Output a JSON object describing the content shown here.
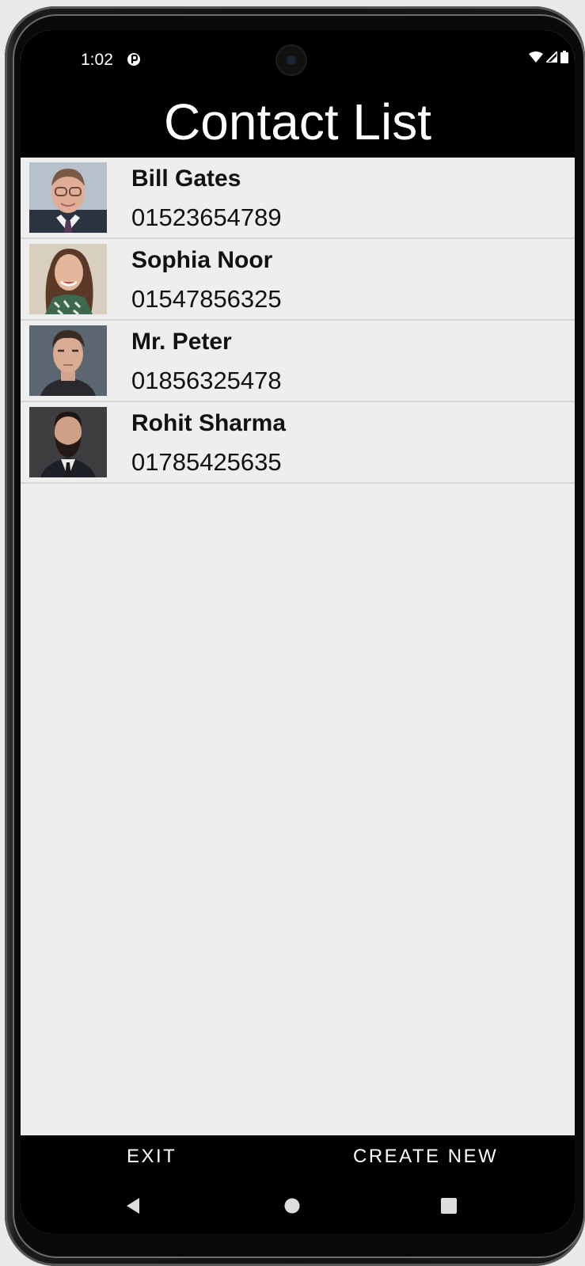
{
  "status_bar": {
    "time": "1:02"
  },
  "app": {
    "title": "Contact List"
  },
  "contacts": [
    {
      "name": "Bill Gates",
      "phone": "01523654789"
    },
    {
      "name": "Sophia Noor",
      "phone": "01547856325"
    },
    {
      "name": "Mr. Peter",
      "phone": "01856325478"
    },
    {
      "name": "Rohit Sharma",
      "phone": "01785425635"
    }
  ],
  "actions": {
    "exit_label": "EXIT",
    "create_label": "CREATE NEW"
  },
  "colors": {
    "bar_background": "#000000",
    "list_background": "#eeeeee",
    "divider": "#d6d6d6"
  }
}
